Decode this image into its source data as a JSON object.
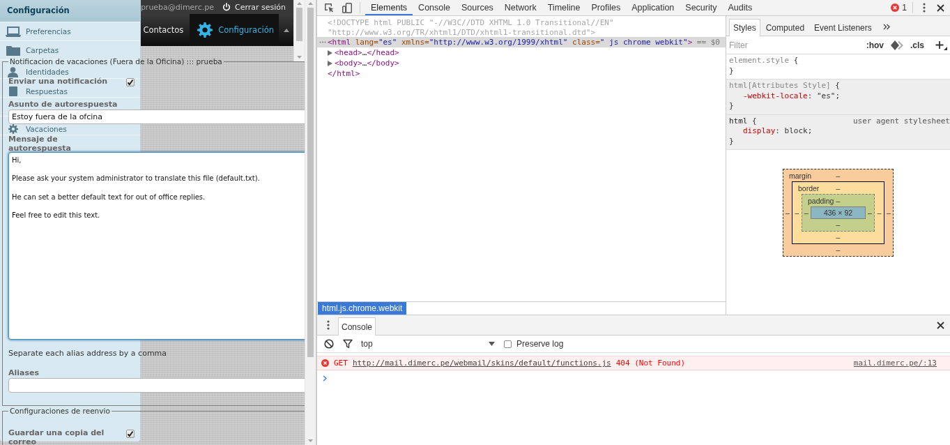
{
  "webmail": {
    "header": {
      "user": "prueba@dimerc.pe",
      "logout": "Cerrar sesión"
    },
    "nav": [
      {
        "label": "Contactos",
        "selected": false
      },
      {
        "label": "Configuración",
        "selected": true
      }
    ],
    "settings_menu": {
      "title": "Configuración",
      "items": [
        {
          "label": "Preferencias"
        },
        {
          "label": "Carpetas"
        },
        {
          "label": "Identidades"
        },
        {
          "label": "Respuestas"
        },
        {
          "label": "Vacaciones"
        }
      ]
    },
    "vacation": {
      "legend": "Notificacion de vacaciones (Fuera de la Oficina) ::: prueba",
      "fields": [
        {
          "kind": "checkbox",
          "label": "Enviar una notificación",
          "checked": true
        },
        {
          "kind": "text",
          "label": "Asunto de autorespuesta",
          "value": "Estoy fuera de la ofcina"
        },
        {
          "kind": "textarea",
          "label": "Mensaje de autorespuesta",
          "value": "Hi,\n\nPlease ask your system administrator to translate this file (default.txt).\n\nHe can set a better default text for out of office replies.\n\nFeel free to edit this text.",
          "focused": true
        },
        {
          "kind": "hint",
          "text": "Separate each alias address by a comma"
        },
        {
          "kind": "text",
          "label": "Aliases"
        }
      ]
    },
    "forwarding": {
      "legend": "Configuraciones de reenvio",
      "fields": [
        {
          "kind": "checkbox",
          "label": "Guardar una copia del correo",
          "checked": true
        }
      ]
    }
  },
  "devtools": {
    "tabs": [
      {
        "label": "Elements",
        "selected": true
      },
      {
        "label": "Console",
        "selected": false
      },
      {
        "label": "Sources",
        "selected": false
      },
      {
        "label": "Network",
        "selected": false
      },
      {
        "label": "Timeline",
        "selected": false
      },
      {
        "label": "Profiles",
        "selected": false
      },
      {
        "label": "Application",
        "selected": false
      },
      {
        "label": "Security",
        "selected": false
      },
      {
        "label": "Audits",
        "selected": false
      }
    ],
    "error_count": "1",
    "dom_tree": [
      {
        "kind": "doctype",
        "lines": [
          "<!DOCTYPE html PUBLIC \"-//W3C//DTD XHTML 1.0 Transitional//EN\"",
          "\"http://www.w3.org/TR/xhtml1/DTD/xhtml1-transitional.dtd\">"
        ]
      },
      {
        "kind": "element",
        "selected": true,
        "segments": [
          {
            "kind": "tag",
            "text": "<html"
          },
          {
            "kind": "attr",
            "text": " lang="
          },
          {
            "kind": "value",
            "text": "\"es\""
          },
          {
            "kind": "attr",
            "text": " xmlns="
          },
          {
            "kind": "value",
            "text": "\"http://www.w3.org/1999/xhtml\""
          },
          {
            "kind": "attr",
            "text": " class="
          },
          {
            "kind": "value",
            "text": "\" js chrome webkit\""
          },
          {
            "kind": "tag",
            "text": ">"
          }
        ],
        "marker": " == $0",
        "children": [
          {
            "kind": "element",
            "selected": false,
            "expanded": false,
            "segments": [
              {
                "kind": "tag",
                "text": "<head>"
              },
              {
                "kind": "text",
                "text": "…"
              },
              {
                "kind": "tag",
                "text": "</head>"
              }
            ]
          },
          {
            "kind": "element",
            "selected": false,
            "expanded": false,
            "segments": [
              {
                "kind": "tag",
                "text": "<body>"
              },
              {
                "kind": "text",
                "text": "…"
              },
              {
                "kind": "tag",
                "text": "</body>"
              }
            ]
          }
        ],
        "closing": [
          {
            "kind": "tag",
            "text": "</html>"
          }
        ]
      }
    ],
    "breadcrumbs": [
      {
        "label": "html.js.chrome.webkit",
        "selected": true
      }
    ],
    "sidebar_tabs": [
      {
        "label": "Styles",
        "selected": true
      },
      {
        "label": "Computed",
        "selected": false
      },
      {
        "label": "Event Listeners",
        "selected": false
      }
    ],
    "filter": {
      "placeholder": "Filter",
      "buttons": [
        ":hov",
        ".cls"
      ]
    },
    "rules": [
      {
        "kind": "inline",
        "selector": "element.style",
        "open": " {",
        "close": "}"
      },
      {
        "kind": "attributes",
        "selector": "html[Attributes Style]",
        "open": " {",
        "declarations": [
          {
            "property": "-webkit-locale",
            "value": ": \"es\";"
          }
        ],
        "close": "}"
      },
      {
        "kind": "user_agent",
        "selector": "html",
        "open": " {",
        "source": "user agent stylesheet",
        "declarations": [
          {
            "property": "display",
            "value": ": block;"
          }
        ],
        "close": "}"
      }
    ],
    "box_model": {
      "kind": "margin",
      "label": "margin",
      "top": "–",
      "left": "–",
      "inner": {
        "kind": "border",
        "label": "border",
        "top": "–",
        "left": "–",
        "inner": {
          "kind": "padding",
          "label": "padding",
          "top": "–",
          "left": "–",
          "content": "436 × 92",
          "right": "–",
          "bottom": "–"
        },
        "right": "–",
        "bottom": "–"
      },
      "right": "–",
      "bottom": "–"
    },
    "drawer": {
      "tabs": [
        {
          "label": "Console",
          "selected": true
        }
      ],
      "context": "top",
      "preserve_log": {
        "label": "Preserve log",
        "checked": false
      },
      "messages": [
        {
          "kind": "error",
          "method": "GET",
          "url": "http://mail.dimerc.pe/webmail/skins/default/functions.js",
          "status": "404 (Not Found)",
          "source": "mail.dimerc.pe/:13"
        }
      ]
    }
  }
}
